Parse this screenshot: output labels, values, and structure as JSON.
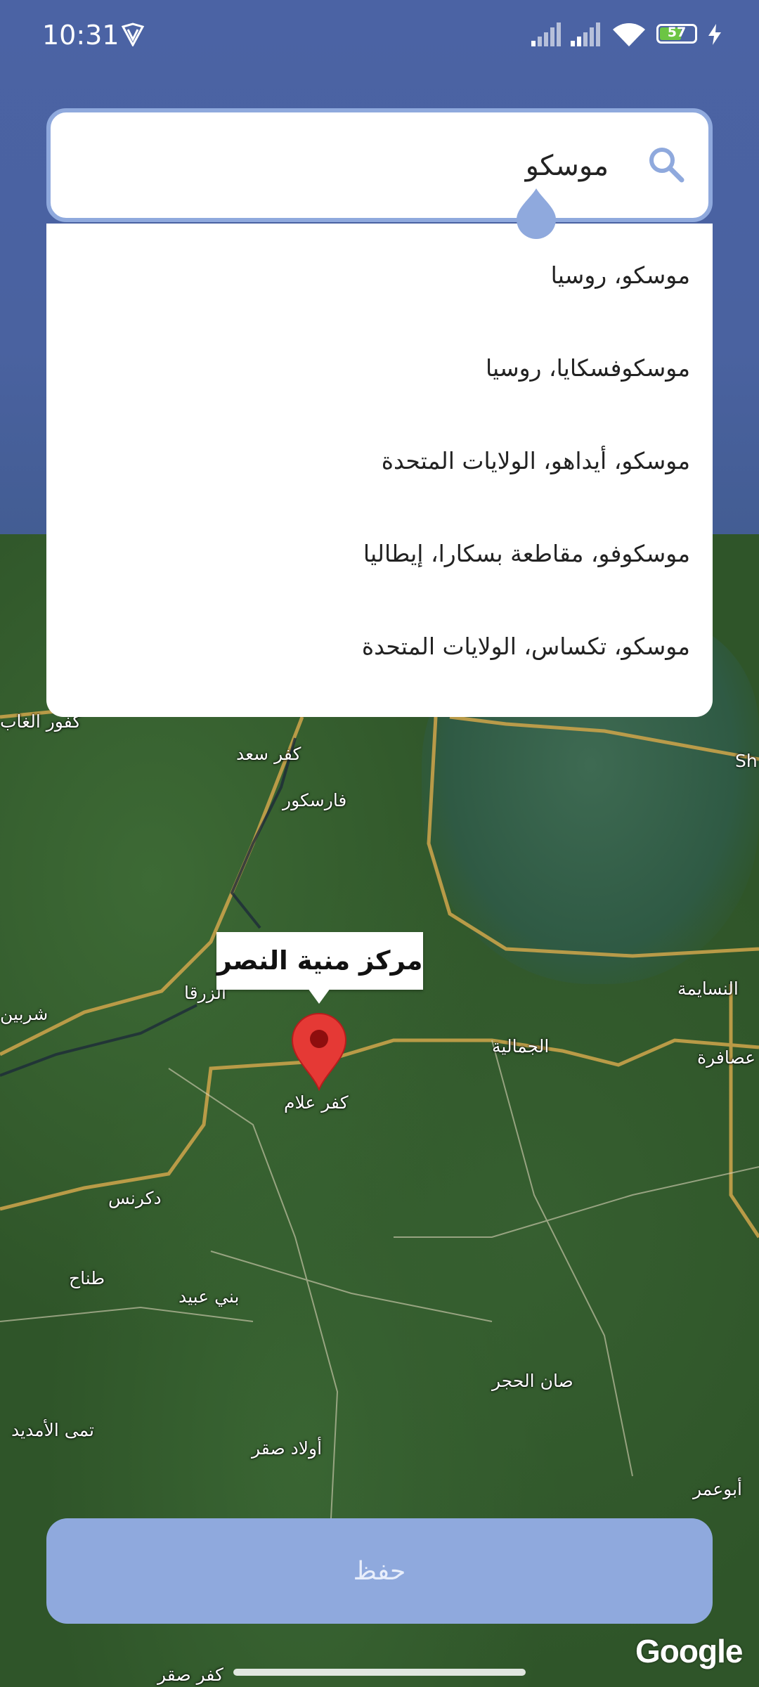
{
  "status_bar": {
    "time": "10:31",
    "battery_level": "57"
  },
  "search": {
    "value": "موسكو",
    "icon": "search-icon"
  },
  "suggestions": [
    "موسكو، روسيا",
    "موسكوفسكايا، روسيا",
    "موسكو، أيداهو، الولايات المتحدة",
    "موسكوفو، مقاطعة بسكارا، إيطاليا",
    "موسكو، تكساس، الولايات المتحدة"
  ],
  "map": {
    "pin_label": "مركز منية النصر",
    "places": {
      "kafr_saad": "كفر سعد",
      "faraskour": "فارسكور",
      "zarqa": "الزرقا",
      "shirbin": "شربين",
      "kafr_allam": "كفر علام",
      "gamalia": "الجمالية",
      "nasayma": "النسايمة",
      "asafra": "عصافرة",
      "dekernes": "دكرنس",
      "tanah": "طناح",
      "bani_ebeid": "بني عبيد",
      "san_elhagar": "صان الحجر",
      "tama_elamdid": "تمى الأمديد",
      "awlad_saqr": "أولاد صقر",
      "abu_omar": "أبوعمر",
      "kafr_ghab": "كفور الغاب",
      "kafr_bottom": "كفر صقر",
      "sh": "Sh"
    },
    "attribution": "Google"
  },
  "save_button": "حفظ"
}
